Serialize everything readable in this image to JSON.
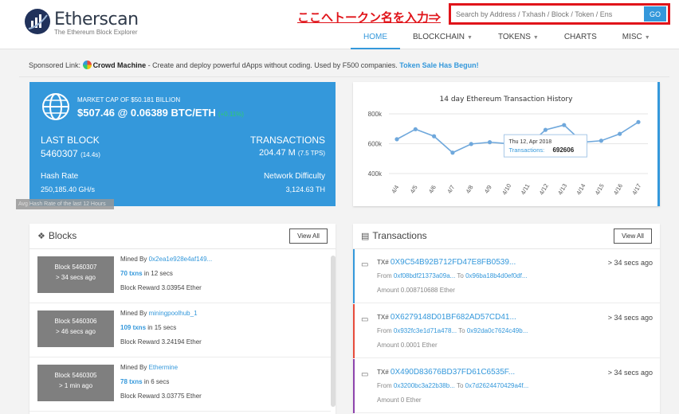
{
  "header": {
    "logo_name": "Etherscan",
    "logo_tagline": "The Ethereum Block Explorer",
    "annotation": "ここへトークン名を入力⇒",
    "search_placeholder": "Search by Address / Txhash / Block / Token / Ens",
    "search_button": "GO"
  },
  "nav": [
    {
      "label": "HOME",
      "active": true,
      "caret": false
    },
    {
      "label": "BLOCKCHAIN",
      "active": false,
      "caret": true
    },
    {
      "label": "TOKENS",
      "active": false,
      "caret": true
    },
    {
      "label": "CHARTS",
      "active": false,
      "caret": false
    },
    {
      "label": "MISC",
      "active": false,
      "caret": true
    }
  ],
  "sponsored": {
    "prefix": "Sponsored Link:",
    "brand": "Crowd Machine",
    "text": "- Create and deploy powerful dApps without coding. Used by F500 companies.",
    "cta": "Token Sale Has Begun!"
  },
  "stats": {
    "market_cap_label": "MARKET CAP OF $50.181 BILLION",
    "price": "$507.46 @ 0.06389 BTC/ETH",
    "price_change": "(+0.11%)",
    "last_block_label": "LAST BLOCK",
    "last_block_value": "5460307",
    "last_block_time": "(14.4s)",
    "transactions_label": "TRANSACTIONS",
    "transactions_value": "204.47 M",
    "transactions_tps": "(7.5 TPS)",
    "hash_rate_label": "Hash Rate",
    "hash_rate_value": "250,185.40 GH/s",
    "difficulty_label": "Network Difficulty",
    "difficulty_value": "3,124.63 TH",
    "hash_tooltip": "Avg Hash Rate of the last 12 Hours"
  },
  "chart_data": {
    "type": "line",
    "title": "14 day Ethereum Transaction History",
    "categories": [
      "4/4",
      "4/5",
      "4/6",
      "4/7",
      "4/8",
      "4/9",
      "4/10",
      "4/11",
      "4/12",
      "4/13",
      "4/14",
      "4/15",
      "4/16",
      "4/17"
    ],
    "series": [
      {
        "values": [
          630000,
          697000,
          650000,
          540000,
          598000,
          610000,
          600000,
          580000,
          692606,
          725000,
          610000,
          620000,
          666000,
          745000
        ]
      }
    ],
    "ytick_labels": [
      "400k",
      "600k",
      "800k"
    ],
    "ylim": [
      400000,
      800000
    ],
    "grid": true,
    "color": "#6fa8dc",
    "tooltip": {
      "date": "Thu 12, Apr 2018",
      "label": "Transactions:",
      "value": "692606",
      "index": 8
    }
  },
  "blocks": {
    "title": "Blocks",
    "view_all": "View All",
    "items": [
      {
        "number": "Block 5460307",
        "age": "> 34 secs ago",
        "mined_by_label": "Mined By",
        "miner": "0x2ea1e928e4af149...",
        "txns": "70 txns",
        "txns_time": "in 12 secs",
        "reward": "Block Reward 3.03954 Ether"
      },
      {
        "number": "Block 5460306",
        "age": "> 46 secs ago",
        "mined_by_label": "Mined By",
        "miner": "miningpoolhub_1",
        "txns": "109 txns",
        "txns_time": "in 15 secs",
        "reward": "Block Reward 3.24194 Ether"
      },
      {
        "number": "Block 5460305",
        "age": "> 1 min ago",
        "mined_by_label": "Mined By",
        "miner": "Ethermine",
        "txns": "78 txns",
        "txns_time": "in 6 secs",
        "reward": "Block Reward 3.03775 Ether"
      }
    ]
  },
  "transactions": {
    "title": "Transactions",
    "view_all": "View All",
    "items": [
      {
        "hash_label": "TX#",
        "hash": "0X9C54B92B712FD47E8FB0539...",
        "age": "> 34 secs ago",
        "from_label": "From",
        "from": "0xf08bdf21373a09a...",
        "to_label": "To",
        "to": "0x96ba18b4d0ef0df...",
        "amount": "Amount 0.008710688 Ether",
        "color": "#3498db"
      },
      {
        "hash_label": "TX#",
        "hash": "0X6279148D01BF682AD57CD41...",
        "age": "> 34 secs ago",
        "from_label": "From",
        "from": "0x932fc3e1d71a478...",
        "to_label": "To",
        "to": "0x92da0c7624c49b...",
        "amount": "Amount 0.0001 Ether",
        "color": "#e74c3c"
      },
      {
        "hash_label": "TX#",
        "hash": "0X490D83676BD37FD61C6535F...",
        "age": "> 34 secs ago",
        "from_label": "From",
        "from": "0x3200bc3a22b38b...",
        "to_label": "To",
        "to": "0x7d2624470429a4f...",
        "amount": "Amount 0 Ether",
        "color": "#8e44ad"
      }
    ]
  }
}
